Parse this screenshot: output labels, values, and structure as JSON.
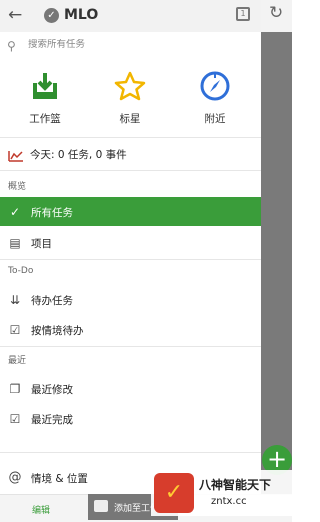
{
  "header": {
    "title": "MLO",
    "back_icon": "arrow-left-icon",
    "logo_icon": "check-badge-icon"
  },
  "search": {
    "placeholder": "搜索所有任务"
  },
  "quick_actions": [
    {
      "label": "工作篮",
      "icon": "inbox-download-icon"
    },
    {
      "label": "标星",
      "icon": "star-icon"
    },
    {
      "label": "附近",
      "icon": "compass-icon"
    }
  ],
  "today": {
    "label": "今天: 0 任务, 0 事件"
  },
  "sections": {
    "overview": "概览",
    "todo": "To-Do",
    "recent": "最近"
  },
  "nav": {
    "all_tasks": "所有任务",
    "projects": "项目",
    "todo_tasks": "待办任务",
    "context_todo": "按情境待办",
    "recent_modified": "最近修改",
    "recent_completed": "最近完成",
    "contexts_places": "情境 & 位置"
  },
  "bottom": {
    "edit_label": "编辑",
    "toast": "添加至工作篮"
  },
  "watermark": {
    "line1": "八神智能天下",
    "line2": "zntx.cc"
  },
  "colors": {
    "accent": "#3a9d3a",
    "star": "#f2b600",
    "compass": "#2f6fd8"
  }
}
